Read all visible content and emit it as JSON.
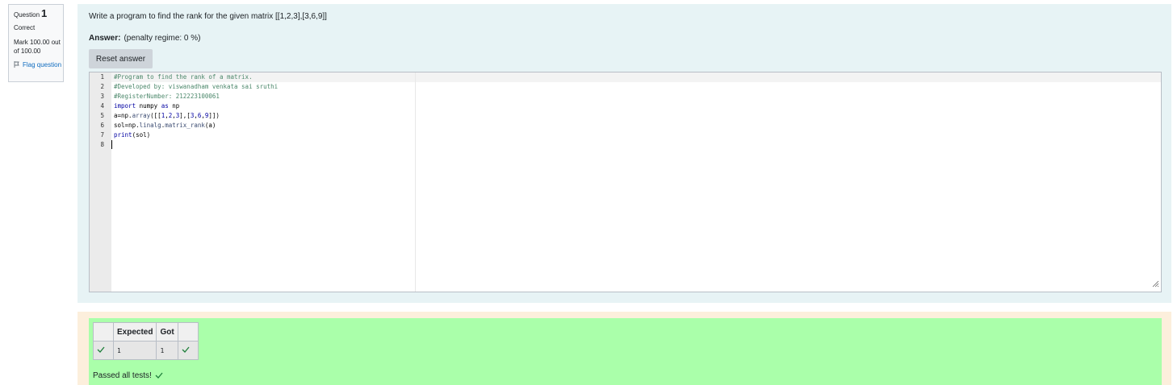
{
  "info": {
    "question_prefix": "Question",
    "question_number": "1",
    "state": "Correct",
    "grade": "Mark 100.00 out of 100.00",
    "flag_label": "Flag question"
  },
  "question": {
    "text": "Write a program to find the rank for the given matrix [[1,2,3],[3,6,9]]",
    "answer_label": "Answer:",
    "penalty": "(penalty regime: 0 %)",
    "reset_label": "Reset answer"
  },
  "editor": {
    "line_numbers": [
      "1",
      "2",
      "3",
      "4",
      "5",
      "6",
      "7",
      "8"
    ],
    "lines": [
      "#Program to find the rank of a matrix.",
      "#Developed by: viswanadham venkata sai sruthi",
      "#RegisterNumber: 212223100061",
      "import numpy as np",
      "a=np.array([[1,2,3],[3,6,9]])",
      "sol=np.linalg.matrix_rank(a)",
      "print(sol)",
      ""
    ]
  },
  "results": {
    "headers": [
      "",
      "Expected",
      "Got",
      ""
    ],
    "rows": [
      {
        "expected": "1",
        "got": "1",
        "status": "pass"
      }
    ],
    "summary": "Passed all tests!"
  },
  "colors": {
    "formulation_bg": "#e7f3f5",
    "outcome_bg": "#fcefdc",
    "result_bg": "#aaffaa",
    "check": "#1e7f3a",
    "link": "#0f6cbf"
  }
}
